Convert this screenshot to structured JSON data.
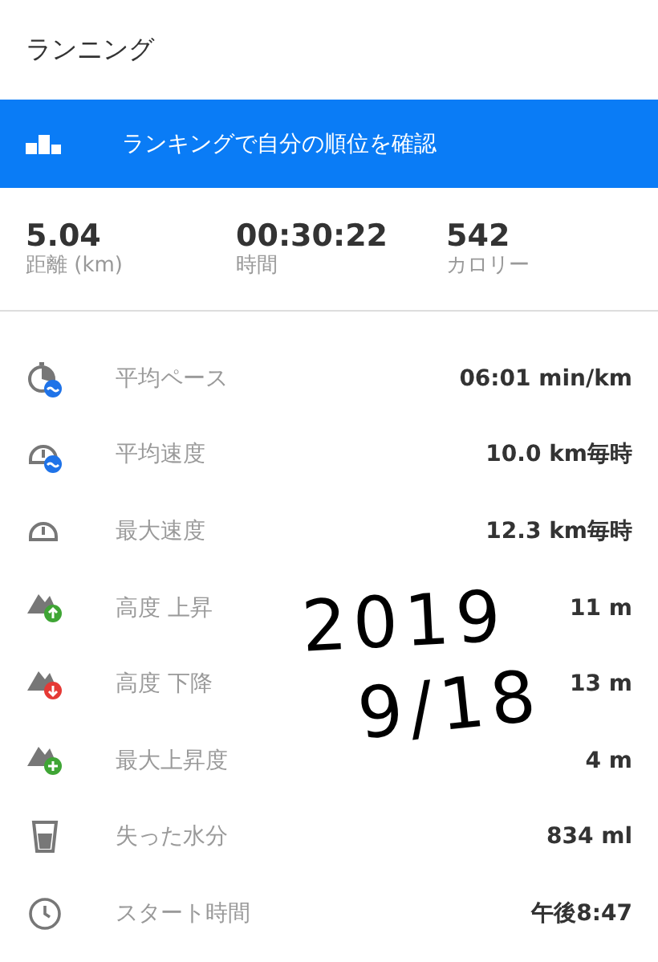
{
  "title": "ランニング",
  "banner": {
    "label": "ランキングで自分の順位を確認"
  },
  "summary": [
    {
      "value": "5.04",
      "label": "距離 (km)"
    },
    {
      "value": "00:30:22",
      "label": "時間"
    },
    {
      "value": "542",
      "label": "カロリー"
    }
  ],
  "details": [
    {
      "kind": "pace",
      "label": "平均ペース",
      "value": "06:01 min/km"
    },
    {
      "kind": "avg_speed",
      "label": "平均速度",
      "value": "10.0 km毎時"
    },
    {
      "kind": "max_speed",
      "label": "最大速度",
      "value": "12.3 km毎時"
    },
    {
      "kind": "ascent",
      "label": "高度 上昇",
      "value": "11 m"
    },
    {
      "kind": "descent",
      "label": "高度 下降",
      "value": "13 m"
    },
    {
      "kind": "max_ascent",
      "label": "最大上昇度",
      "value": "4 m"
    },
    {
      "kind": "water",
      "label": "失った水分",
      "value": "834 ml"
    },
    {
      "kind": "clock",
      "label": "スタート時間",
      "value": "午後8:47"
    }
  ],
  "handwritten_note": [
    "2019",
    "9/18"
  ]
}
